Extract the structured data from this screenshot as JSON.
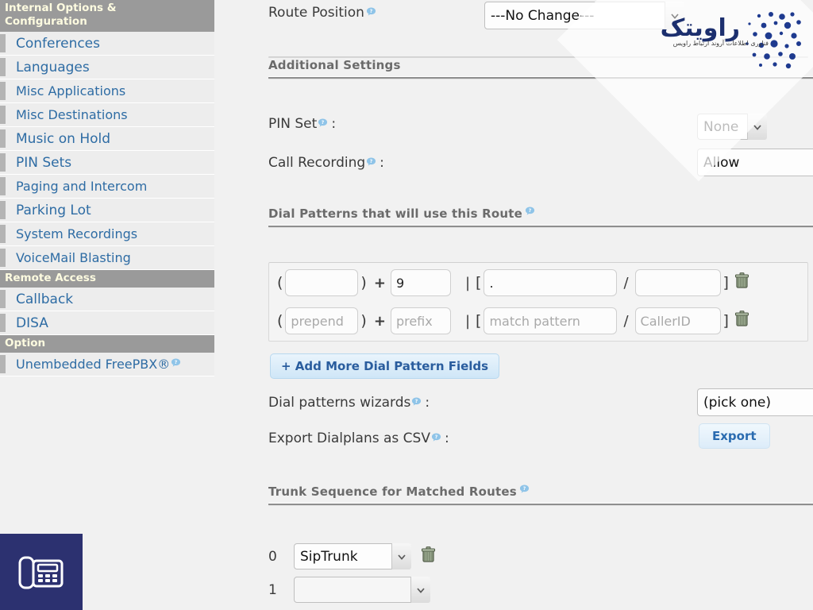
{
  "sidebar": {
    "sections": [
      {
        "header": "Internal Options & Configuration",
        "two_line": true,
        "items": [
          {
            "label": "Conferences",
            "help": false
          },
          {
            "label": "Languages",
            "help": false
          },
          {
            "label": "Misc Applications",
            "help": false
          },
          {
            "label": "Misc Destinations",
            "help": false
          },
          {
            "label": "Music on Hold",
            "help": false
          },
          {
            "label": "PIN Sets",
            "help": false
          },
          {
            "label": "Paging and Intercom",
            "help": false
          },
          {
            "label": "Parking Lot",
            "help": false
          },
          {
            "label": "System Recordings",
            "help": false
          },
          {
            "label": "VoiceMail Blasting",
            "help": false
          }
        ]
      },
      {
        "header": "Remote Access",
        "two_line": false,
        "items": [
          {
            "label": "Callback",
            "help": false
          },
          {
            "label": "DISA",
            "help": false
          }
        ]
      },
      {
        "header": "Option",
        "two_line": false,
        "items": [
          {
            "label": "Unembedded FreePBX®",
            "help": true
          }
        ]
      }
    ]
  },
  "main": {
    "route_position": {
      "label": "Route Position",
      "help": true,
      "value": "---No Change---",
      "options": [
        "---No Change---"
      ]
    },
    "additional_settings": {
      "title": "Additional Settings",
      "pin_set": {
        "label": "PIN Set",
        "suffix": ":",
        "help": true,
        "value": "None",
        "options": [
          "None"
        ]
      },
      "call_recording": {
        "label": "Call Recording",
        "suffix": ":",
        "help": true,
        "value": "Allow",
        "options": [
          "Allow"
        ]
      }
    },
    "dial_patterns": {
      "title": "Dial Patterns that will use this Route",
      "help": true,
      "rows": [
        {
          "prepend": "",
          "prefix": "9",
          "match_pattern": ".",
          "callerid": "",
          "prepend_placeholder": "",
          "prefix_placeholder": "",
          "match_placeholder": "",
          "callerid_placeholder": "",
          "delete_icon": "trash-icon"
        },
        {
          "prepend": "",
          "prefix": "",
          "match_pattern": "",
          "callerid": "",
          "prepend_placeholder": "prepend",
          "prefix_placeholder": "prefix",
          "match_placeholder": "match pattern",
          "callerid_placeholder": "CallerID",
          "delete_icon": "trash-icon"
        }
      ],
      "symbols": {
        "open_paren": "(",
        "close_paren": ")",
        "plus": "+",
        "pipe": "|",
        "open_bracket": "[",
        "slash": "/",
        "close_bracket": "]"
      },
      "add_button": "+ Add More Dial Pattern Fields",
      "wizards": {
        "label": "Dial patterns wizards",
        "suffix": ":",
        "help": true,
        "value": "(pick one)",
        "options": [
          "(pick one)"
        ]
      },
      "export": {
        "label": "Export Dialplans as CSV",
        "suffix": ":",
        "help": true,
        "button": "Export"
      }
    },
    "trunk_sequence": {
      "title": "Trunk Sequence for Matched Routes",
      "help": true,
      "rows": [
        {
          "index": "0",
          "value": "SipTrunk",
          "options": [
            "SipTrunk"
          ],
          "has_delete": true
        },
        {
          "index": "1",
          "value": "",
          "options": [
            ""
          ],
          "has_delete": false
        }
      ]
    }
  },
  "watermark": {
    "brand_fa": "راویتک",
    "tagline_fa": "فناوری اطلاعات آروند ارتباط راویس",
    "dot_color": "#1e3a8f"
  },
  "phone_tile": {
    "icon": "desk-phone-icon",
    "bg": "#2c3170"
  },
  "colors": {
    "page_bg": "#f1f1f1",
    "nav_header_bg": "#9a9a9a",
    "nav_header_text": "#fdfbe0",
    "nav_item_bg": "#ededed",
    "nav_link": "#2e6ca4",
    "section_title": "#6b6b6b",
    "accent_blue": "#2a5d9e"
  }
}
